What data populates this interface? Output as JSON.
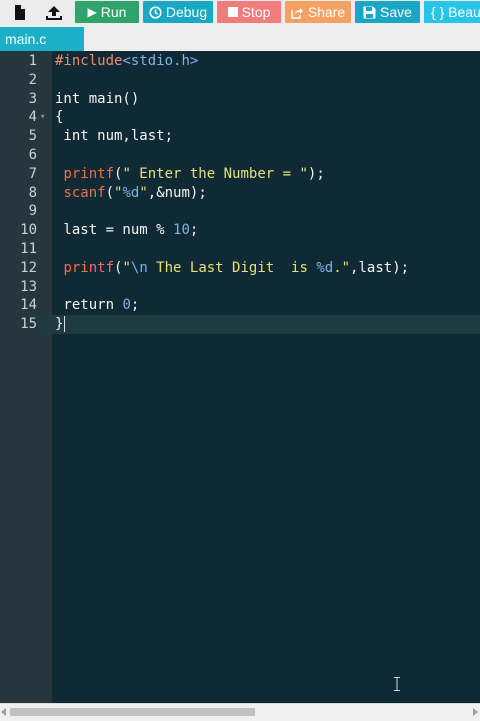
{
  "toolbar": {
    "new_file_icon": "file-icon",
    "upload_icon": "upload-icon",
    "run_label": "Run",
    "debug_label": "Debug",
    "stop_label": "Stop",
    "share_label": "Share",
    "save_label": "Save",
    "beautify_label": "{ } Beautify",
    "colors": {
      "run": "#2fa46a",
      "debug": "#19a8c4",
      "stop": "#f07c7c",
      "share": "#f6a162",
      "save": "#19a8c4",
      "beautify": "#27c6e8"
    }
  },
  "tabs": [
    {
      "label": "main.c",
      "active": true
    }
  ],
  "editor": {
    "language": "c",
    "active_line": 15,
    "lines": [
      {
        "n": "1",
        "text": "#include<stdio.h>"
      },
      {
        "n": "2",
        "text": ""
      },
      {
        "n": "3",
        "text": "int main()"
      },
      {
        "n": "4",
        "text": "{"
      },
      {
        "n": "5",
        "text": " int num,last;"
      },
      {
        "n": "6",
        "text": ""
      },
      {
        "n": "7",
        "text": " printf(\" Enter the Number = \");"
      },
      {
        "n": "8",
        "text": " scanf(\"%d\",&num);"
      },
      {
        "n": "9",
        "text": ""
      },
      {
        "n": "10",
        "text": " last = num % 10;"
      },
      {
        "n": "11",
        "text": ""
      },
      {
        "n": "12",
        "text": " printf(\"\\n The Last Digit  is %d.\",last);"
      },
      {
        "n": "13",
        "text": ""
      },
      {
        "n": "14",
        "text": " return 0;"
      },
      {
        "n": "15",
        "text": "}"
      }
    ]
  }
}
